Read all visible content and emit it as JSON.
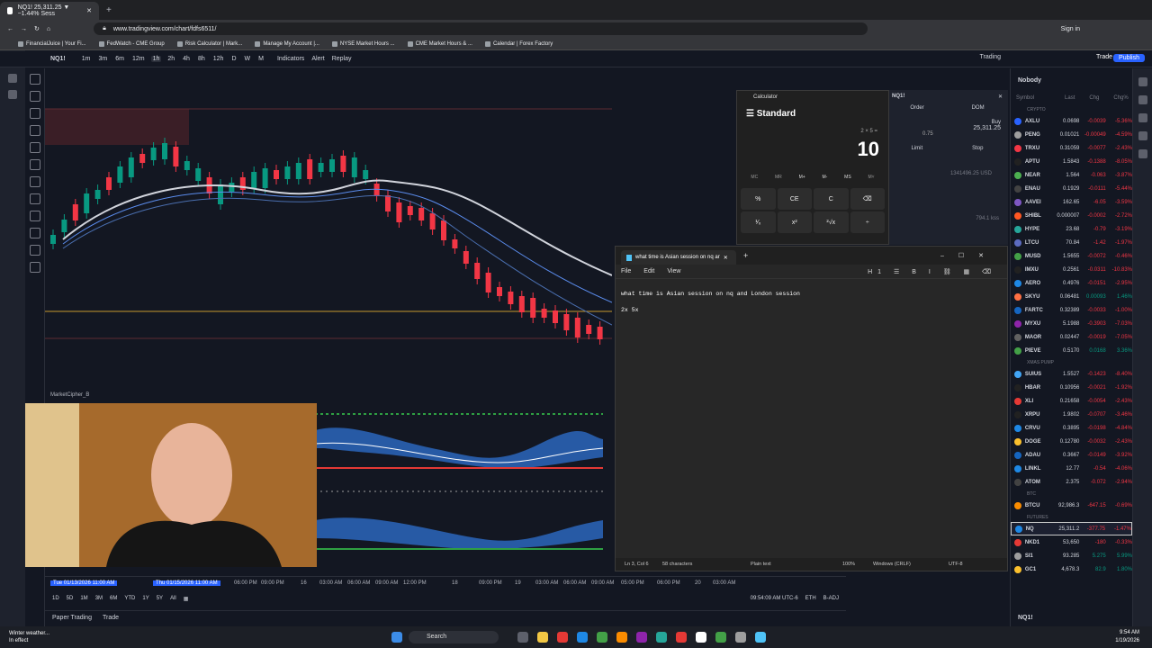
{
  "browser": {
    "tab_title": "NQ1! 25,311.25 ▼ −1.44% Sess",
    "url": "www.tradingview.com/chart/fdfs6511/",
    "signin": "Sign in",
    "bookmarks": [
      "FinancialJuice | Your Fi...",
      "FedWatch - CME Group",
      "Risk Calculator | Mark...",
      "Manage My Account |...",
      "NYSE Market Hours ...",
      "CME Market Hours & ...",
      "Calendar | Forex Factory"
    ]
  },
  "toolbar": {
    "symbol": "NQ1!",
    "intervals": [
      "1m",
      "3m",
      "6m",
      "12m",
      "1h",
      "2h",
      "4h",
      "8h",
      "12h",
      "D",
      "W",
      "M"
    ],
    "active_interval": "1h",
    "indicators": "Indicators",
    "alert": "Alert",
    "replay": "Replay",
    "trading": "Trading",
    "trade": "Trade",
    "publish": "Publish"
  },
  "chart": {
    "indicator_label": "MarketCipher_B",
    "top_price": "26,150.00",
    "time_labels": [
      "Tue 01/13/2026 11:00 AM",
      "Thu 01/15/2026 11:00 AM",
      "06:00 PM",
      "09:00 PM",
      "16",
      "03:00 AM",
      "06:00 AM",
      "09:00 AM",
      "12:00 PM",
      "18",
      "09:00 PM",
      "19",
      "03:00 AM",
      "06:00 AM",
      "09:00 AM",
      "05:00 PM",
      "06:00 PM",
      "20",
      "03:00 AM"
    ],
    "ranges": [
      "1D",
      "5D",
      "1M",
      "3M",
      "6M",
      "YTD",
      "1Y",
      "5Y",
      "All"
    ],
    "clock": "09:54:09 AM UTC-6",
    "exchange": "ETH",
    "adj": "B-ADJ",
    "paper_trading": "Paper Trading",
    "trade_tab": "Trade"
  },
  "calculator": {
    "title": "Calculator",
    "mode": "Standard",
    "expression": "2 × 5 =",
    "result": "10",
    "memory": [
      "MC",
      "MR",
      "M+",
      "M-",
      "MS",
      "M˅"
    ],
    "keys": [
      "%",
      "CE",
      "C",
      "⌫",
      "¹⁄ₓ",
      "x²",
      "²√x",
      "÷"
    ]
  },
  "order_panel": {
    "symbol": "NQ1!",
    "tab": "Order",
    "dom": "DOM",
    "buy": "Buy",
    "buy_price": "25,311.25",
    "qty": "0.75",
    "limit": "Limit",
    "stop": "Stop",
    "usd": "1341496.25 USD",
    "note": "794.1 kss"
  },
  "notepad": {
    "tab_title": "what time is Asian session on nq ar",
    "menu": [
      "File",
      "Edit",
      "View"
    ],
    "lines": [
      "what time is Asian session on nq and London session",
      "2x 5x"
    ],
    "status": {
      "pos": "Ln 3, Col 6",
      "chars": "58 characters",
      "type": "Plain text",
      "zoom": "100%",
      "eol": "Windows (CRLF)",
      "enc": "UTF-8"
    }
  },
  "watchlist": {
    "title": "Nobody",
    "columns": [
      "Symbol",
      "Last",
      "Chg",
      "Chg%"
    ],
    "sections": [
      {
        "name": "CRYPTO",
        "rows": [
          {
            "sym": "AXLU",
            "last": "0.0698",
            "chg": "-0.0039",
            "pct": "-5.36%",
            "color": "#2962ff"
          },
          {
            "sym": "PENG",
            "last": "0.01021",
            "chg": "-0.00049",
            "pct": "-4.59%",
            "color": "#9e9e9e"
          },
          {
            "sym": "TRXU",
            "last": "0.31059",
            "chg": "-0.0077",
            "pct": "-2.43%",
            "color": "#f23645"
          },
          {
            "sym": "APTU",
            "last": "1.5843",
            "chg": "-0.1388",
            "pct": "-8.05%",
            "color": "#212121"
          },
          {
            "sym": "NEAR",
            "last": "1.564",
            "chg": "-0.063",
            "pct": "-3.87%",
            "color": "#4caf50"
          },
          {
            "sym": "ENAU",
            "last": "0.1929",
            "chg": "-0.0111",
            "pct": "-5.44%",
            "color": "#424242"
          },
          {
            "sym": "AAVEI",
            "last": "162.65",
            "chg": "-6.05",
            "pct": "-3.59%",
            "color": "#7e57c2"
          },
          {
            "sym": "SHIBL",
            "last": "0.000007",
            "chg": "-0.0002",
            "pct": "-2.72%",
            "color": "#ff5722"
          },
          {
            "sym": "HYPE",
            "last": "23.68",
            "chg": "-0.79",
            "pct": "-3.19%",
            "color": "#26a69a"
          },
          {
            "sym": "LTCU",
            "last": "70.84",
            "chg": "-1.42",
            "pct": "-1.97%",
            "color": "#5c6bc0"
          },
          {
            "sym": "MUSD",
            "last": "1.5655",
            "chg": "-0.0072",
            "pct": "-0.46%",
            "color": "#43a047"
          },
          {
            "sym": "IMXU",
            "last": "0.2561",
            "chg": "-0.0311",
            "pct": "-10.83%",
            "color": "#212121"
          },
          {
            "sym": "AERO",
            "last": "0.4976",
            "chg": "-0.0151",
            "pct": "-2.95%",
            "color": "#1e88e5"
          },
          {
            "sym": "SKYU",
            "last": "0.06481",
            "chg": "0.00093",
            "pct": "1.46%",
            "color": "#ff7043"
          },
          {
            "sym": "FARTC",
            "last": "0.32389",
            "chg": "-0.0033",
            "pct": "-1.00%",
            "color": "#1565c0"
          },
          {
            "sym": "MYXU",
            "last": "5.1988",
            "chg": "-0.3903",
            "pct": "-7.03%",
            "color": "#8e24aa"
          },
          {
            "sym": "MAOR",
            "last": "0.02447",
            "chg": "-0.0019",
            "pct": "-7.05%",
            "color": "#616161"
          },
          {
            "sym": "PIEVE",
            "last": "0.5170",
            "chg": "0.0168",
            "pct": "3.36%",
            "color": "#43a047"
          }
        ]
      },
      {
        "name": "XMAS PUMP",
        "rows": [
          {
            "sym": "SUIUS",
            "last": "1.5527",
            "chg": "-0.1423",
            "pct": "-8.40%",
            "color": "#42a5f5"
          },
          {
            "sym": "HBAR",
            "last": "0.10956",
            "chg": "-0.0021",
            "pct": "-1.92%",
            "color": "#212121"
          },
          {
            "sym": "XLI",
            "last": "0.21658",
            "chg": "-0.0054",
            "pct": "-2.43%",
            "color": "#e53935"
          },
          {
            "sym": "XRPU",
            "last": "1.9802",
            "chg": "-0.0707",
            "pct": "-3.46%",
            "color": "#212121"
          },
          {
            "sym": "CRVU",
            "last": "0.3895",
            "chg": "-0.0198",
            "pct": "-4.84%",
            "color": "#1e88e5"
          },
          {
            "sym": "DOGE",
            "last": "0.12780",
            "chg": "-0.0032",
            "pct": "-2.43%",
            "color": "#fbc02d"
          },
          {
            "sym": "ADAU",
            "last": "0.3667",
            "chg": "-0.0149",
            "pct": "-3.92%",
            "color": "#1565c0"
          },
          {
            "sym": "LINKL",
            "last": "12.77",
            "chg": "-0.54",
            "pct": "-4.06%",
            "color": "#1e88e5"
          },
          {
            "sym": "ATOM",
            "last": "2.375",
            "chg": "-0.072",
            "pct": "-2.94%",
            "color": "#424242"
          }
        ]
      },
      {
        "name": "BTC",
        "rows": [
          {
            "sym": "BTCU",
            "last": "92,986.3",
            "chg": "-647.15",
            "pct": "-0.69%",
            "color": "#fb8c00"
          }
        ]
      },
      {
        "name": "FUTURES",
        "rows": [
          {
            "sym": "NQ",
            "last": "25,311.2",
            "chg": "-377.75",
            "pct": "-1.47%",
            "color": "#1e88e5",
            "sel": true
          },
          {
            "sym": "NKD1",
            "last": "53,650",
            "chg": "-180",
            "pct": "-0.33%",
            "color": "#e53935"
          },
          {
            "sym": "SI1",
            "last": "93.285",
            "chg": "5.275",
            "pct": "5.99%",
            "color": "#9e9e9e"
          },
          {
            "sym": "GC1",
            "last": "4,678.3",
            "chg": "82.9",
            "pct": "1.80%",
            "color": "#fbc02d"
          }
        ]
      }
    ],
    "footer_symbol": "NQ1!"
  },
  "taskbar": {
    "weather_title": "Winter weather...",
    "weather_sub": "In effect",
    "search": "Search",
    "time": "9:54 AM",
    "date": "1/19/2026"
  }
}
